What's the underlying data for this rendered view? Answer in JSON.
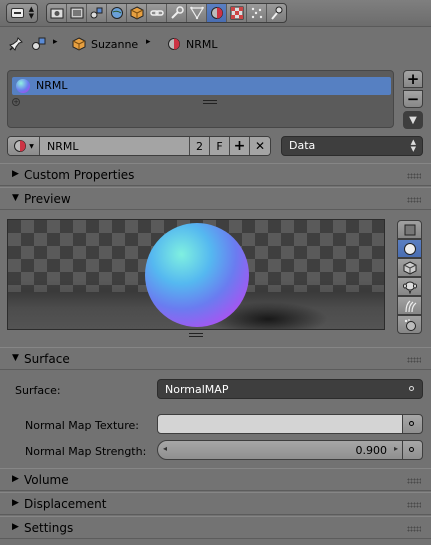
{
  "header": {
    "context_tabs": [
      {
        "icon": "render-icon"
      },
      {
        "icon": "render-layers-icon"
      },
      {
        "icon": "scene-icon"
      },
      {
        "icon": "world-icon"
      },
      {
        "icon": "object-icon"
      },
      {
        "icon": "constraints-icon"
      },
      {
        "icon": "modifiers-icon"
      },
      {
        "icon": "data-icon"
      },
      {
        "icon": "material-icon",
        "active": true
      },
      {
        "icon": "texture-icon"
      },
      {
        "icon": "particles-icon"
      },
      {
        "icon": "physics-icon"
      }
    ]
  },
  "breadcrumb": {
    "object": "Suzanne",
    "material": "NRML"
  },
  "slots": {
    "items": [
      {
        "label": "NRML",
        "selected": true
      }
    ]
  },
  "datablock": {
    "name": "NRML",
    "users": "2",
    "fake_user": "F",
    "link": "Data"
  },
  "panels": {
    "custom_properties": "Custom Properties",
    "preview": "Preview",
    "surface": "Surface",
    "volume": "Volume",
    "displacement": "Displacement",
    "settings": "Settings"
  },
  "surface": {
    "surface_label": "Surface:",
    "surface_value": "NormalMAP",
    "normal_map_texture_label": "Normal Map Texture:",
    "normal_map_texture_value": "",
    "normal_map_strength_label": "Normal Map Strength:",
    "normal_map_strength_value": "0.900"
  },
  "preview_shapes": [
    "flat-icon",
    "sphere-icon",
    "cube-icon",
    "monkey-icon",
    "hair-icon",
    "sphere-a-icon"
  ],
  "colors": {
    "accent": "#5680c2",
    "background": "#727272"
  }
}
